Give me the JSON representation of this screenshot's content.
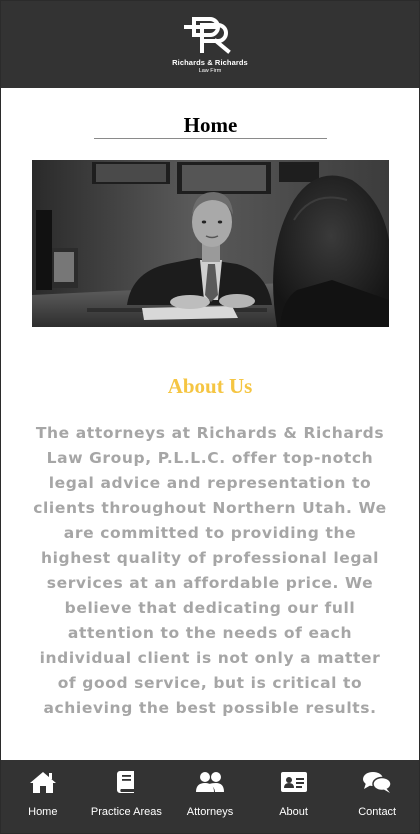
{
  "header": {
    "logo_name": "Richards & Richards",
    "logo_subtitle": "Law Firm"
  },
  "page": {
    "title": "Home"
  },
  "hero": {
    "alt": "Attorney in suit meeting with a client across a desk"
  },
  "about": {
    "heading": "About Us",
    "body": "The attorneys at Richards & Richards Law Group, P.L.L.C. offer top-notch legal advice and representation to clients throughout Northern Utah. We are committed to providing the highest quality of professional legal services at an affordable price. We believe that dedicating our full attention to the needs of each individual client is not only a matter of good service, but is critical to achieving the best possible results."
  },
  "nav": {
    "items": [
      {
        "label": "Home",
        "icon": "home-icon"
      },
      {
        "label": "Practice Areas",
        "icon": "book-icon"
      },
      {
        "label": "Attorneys",
        "icon": "users-icon"
      },
      {
        "label": "About",
        "icon": "id-card-icon"
      },
      {
        "label": "Contact",
        "icon": "chat-bubbles-icon"
      }
    ]
  },
  "colors": {
    "header_bg": "#333333",
    "accent": "#f5c542",
    "body_text": "#a6a6a6"
  }
}
